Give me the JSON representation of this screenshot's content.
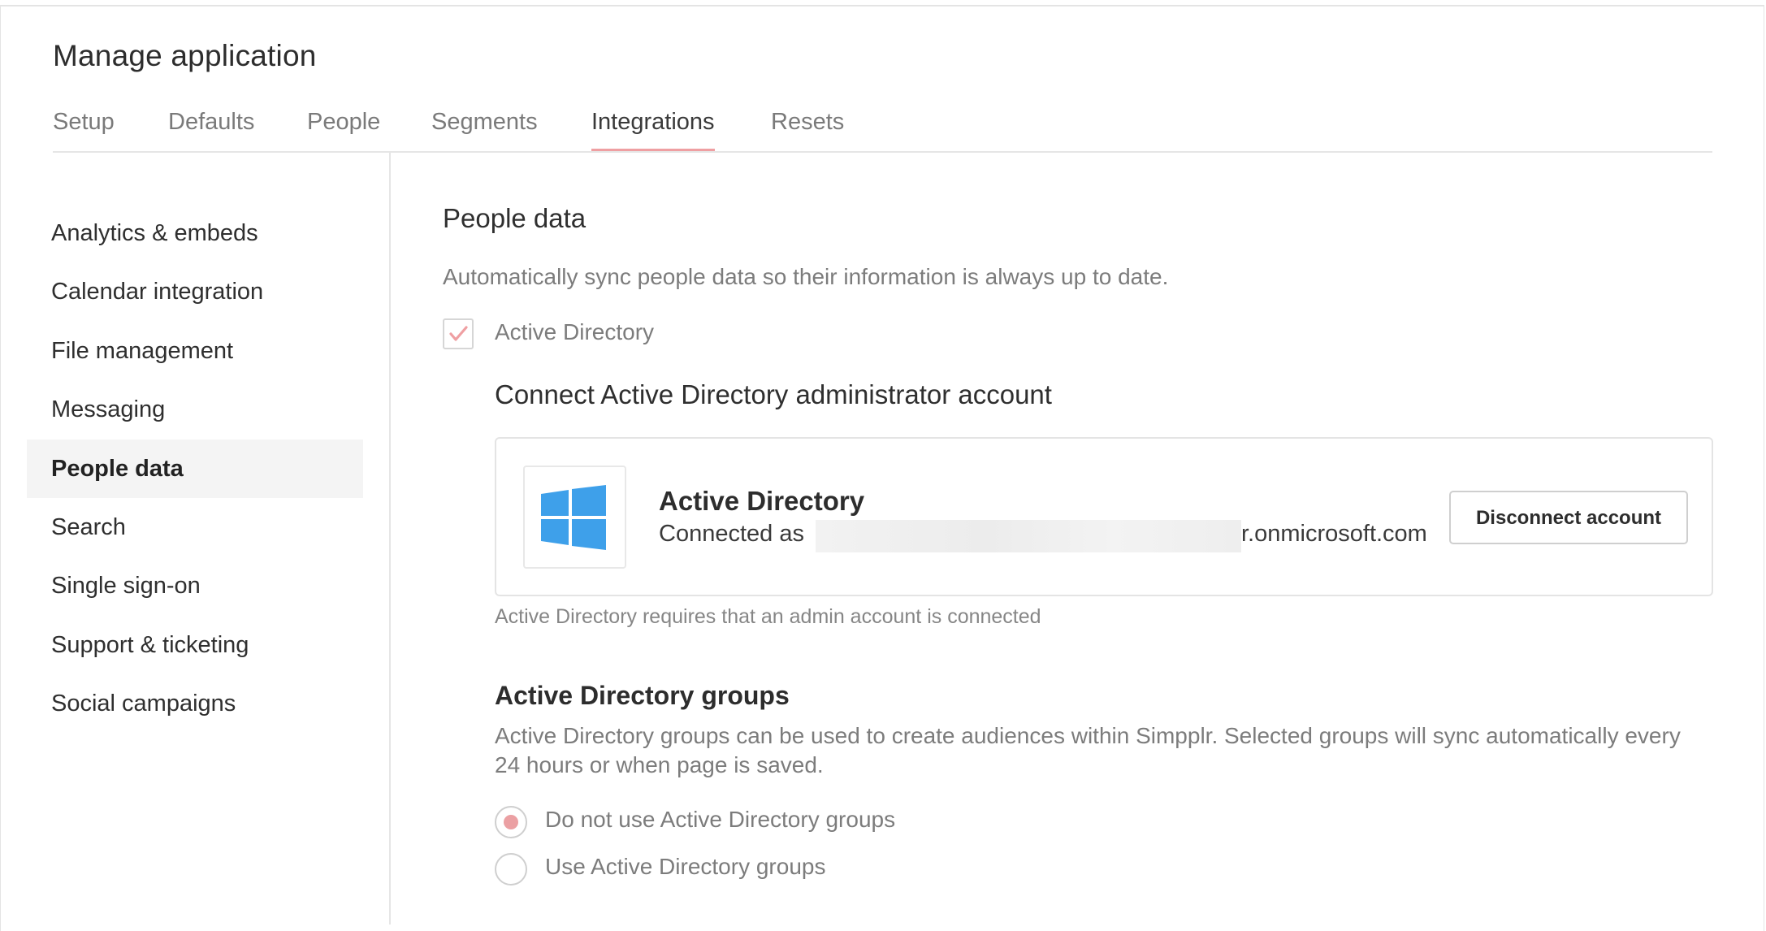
{
  "page": {
    "title": "Manage application"
  },
  "tabs": [
    {
      "label": "Setup",
      "active": false
    },
    {
      "label": "Defaults",
      "active": false
    },
    {
      "label": "People",
      "active": false
    },
    {
      "label": "Segments",
      "active": false
    },
    {
      "label": "Integrations",
      "active": true
    },
    {
      "label": "Resets",
      "active": false
    }
  ],
  "sidebar": {
    "items": [
      {
        "label": "Analytics & embeds"
      },
      {
        "label": "Calendar integration"
      },
      {
        "label": "File management"
      },
      {
        "label": "Messaging"
      },
      {
        "label": "People data",
        "active": true
      },
      {
        "label": "Search"
      },
      {
        "label": "Single sign-on"
      },
      {
        "label": "Support & ticketing"
      },
      {
        "label": "Social campaigns"
      }
    ]
  },
  "main": {
    "title": "People data",
    "description": "Automatically sync people data so their information is always up to date.",
    "ad_checkbox": {
      "label": "Active Directory",
      "checked": true,
      "icon": "checkmark-icon"
    },
    "connect_heading": "Connect Active Directory administrator account",
    "card": {
      "logo_icon": "windows-logo-icon",
      "name": "Active Directory",
      "connected_prefix": "Connected as",
      "account_suffix": "r.onmicrosoft.com",
      "disconnect_label": "Disconnect account"
    },
    "hint": "Active Directory requires that an admin account is connected",
    "groups": {
      "title": "Active Directory groups",
      "description": "Active Directory groups can be used to create audiences within Simpplr. Selected groups will sync automatically every 24 hours or when page is saved.",
      "options": [
        {
          "label": "Do not use Active Directory groups",
          "selected": true
        },
        {
          "label": "Use Active Directory groups",
          "selected": false
        }
      ]
    }
  },
  "colors": {
    "accent": "#ef9fa2",
    "windows_blue": "#3ea0ea"
  }
}
